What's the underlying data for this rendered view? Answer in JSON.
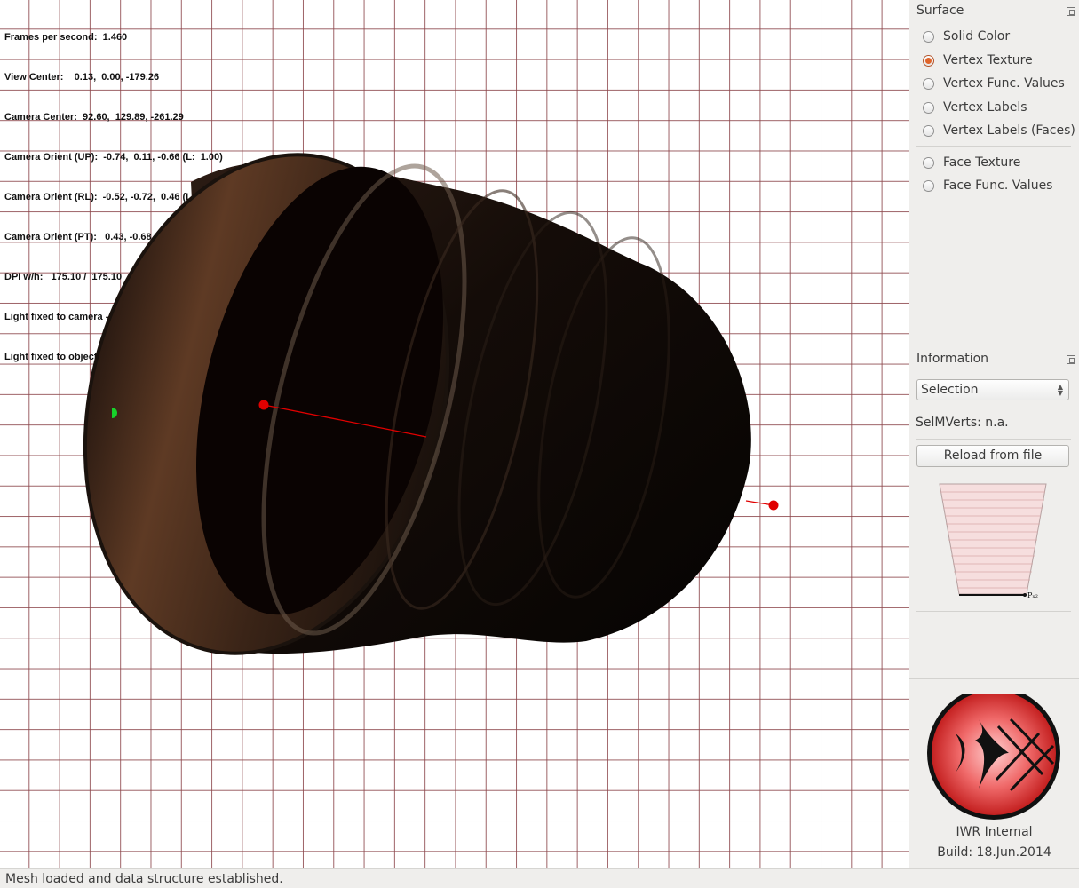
{
  "hud": {
    "lines": [
      "Frames per second:  1.460",
      "View Center:    0.13,  0.00, -179.26",
      "Camera Center:  92.60,  129.89, -261.29",
      "Camera Orient (UP):  -0.74,  0.11, -0.66 (L:  1.00)",
      "Camera Orient (RL):  -0.52, -0.72,  0.46 (L:  1.00)",
      "Camera Orient (PT):   0.43, -0.68, -0.59 (L:  1.00)",
      "DPI w/h:   175.10 /  175.10",
      "Light fixed to camera - Theta:  -40 Phi:  -40",
      "Light fixed to object - Theta:  -40 Phi:  -40"
    ]
  },
  "surface": {
    "title": "Surface",
    "options": [
      {
        "label": "Solid Color",
        "checked": false
      },
      {
        "label": "Vertex Texture",
        "checked": true
      },
      {
        "label": "Vertex Func. Values",
        "checked": false
      },
      {
        "label": "Vertex Labels",
        "checked": false
      },
      {
        "label": "Vertex Labels (Faces)",
        "checked": false
      },
      {
        "label": "Face Texture",
        "checked": false
      },
      {
        "label": "Face Func. Values",
        "checked": false
      }
    ]
  },
  "information": {
    "title": "Information",
    "combo_value": "Selection",
    "selmverts": "SelMVerts: n.a.",
    "reload_label": "Reload from file",
    "funnel_label": "Pₓ₂"
  },
  "logo": {
    "name": "IWR Internal",
    "build": "Build: 18.Jun.2014"
  },
  "status": {
    "message": "Mesh loaded and data structure established."
  },
  "colors": {
    "grid": "#8c464b",
    "selection_point": "#e00000",
    "logo_red": "#e84040",
    "accent_radio": "#e0642a"
  }
}
